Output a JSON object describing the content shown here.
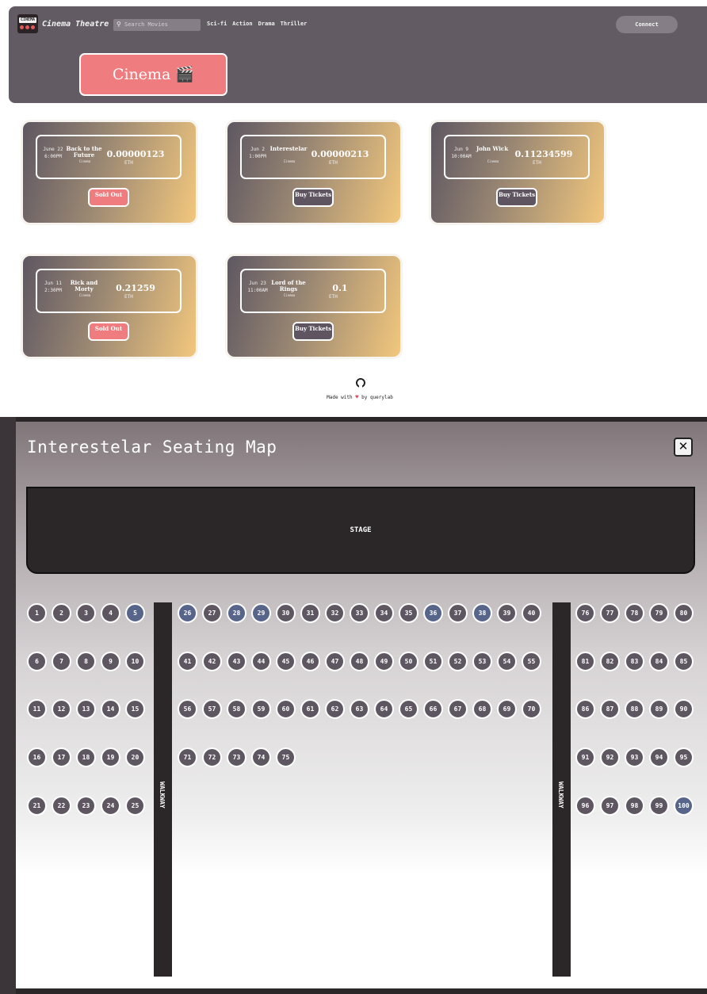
{
  "app": {
    "logo_text": "CINEMA",
    "brand": "Cinema Theatre",
    "search_placeholder": "Search Movies",
    "genres": [
      "Sci-fi",
      "Action",
      "Drama",
      "Thriller"
    ],
    "connect_label": "Connect",
    "hero_title": "Cinema 🎬 Theatre"
  },
  "movies": [
    {
      "date": "June 22 6:00PM",
      "title": "Back to the Future",
      "venue": "Cinema",
      "price": "0.00000123",
      "currency": "ETH",
      "button": "Sold Out",
      "status": "sold"
    },
    {
      "date": "Jun 2 1:00PM",
      "title": "Interestelar",
      "venue": "Cinema",
      "price": "0.00000213",
      "currency": "ETH",
      "button": "Buy Tickets",
      "status": "buy"
    },
    {
      "date": "Jun 9 10:00AM",
      "title": "John Wick",
      "venue": "Cinema",
      "price": "0.11234599",
      "currency": "ETH",
      "button": "Buy Tickets",
      "status": "buy"
    },
    {
      "date": "Jun 11 2:30PM",
      "title": "Rick and Morty",
      "venue": "Cinema",
      "price": "0.21259",
      "currency": "ETH",
      "button": "Sold Out",
      "status": "sold"
    },
    {
      "date": "Jun 23 11:00AM",
      "title": "Lord of the Rings",
      "venue": "Cinema",
      "price": "0.1",
      "currency": "ETH",
      "button": "Buy Tickets",
      "status": "buy"
    }
  ],
  "footer": {
    "prefix": "Made with",
    "heart": "♥",
    "suffix": "by querylab"
  },
  "seating": {
    "title": "Interestelar Seating Map",
    "close_label": "✕",
    "stage_label": "STAGE",
    "walkway_label": "WALKWAY",
    "seat_count": 100,
    "taken_seats": [
      5,
      26,
      28,
      29,
      36,
      38,
      100
    ],
    "colors": {
      "available": "#5e5762",
      "taken": "#566589"
    }
  }
}
